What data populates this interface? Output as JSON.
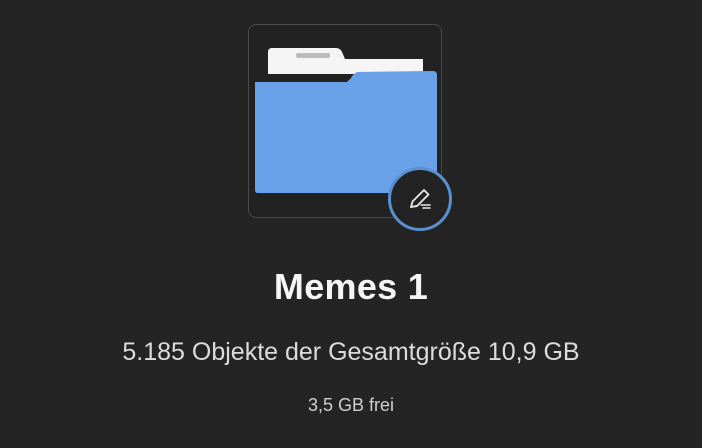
{
  "folder": {
    "name": "Memes 1",
    "summary": "5.185 Objekte der Gesamtgröße 10,9 GB",
    "free_space": "3,5 GB frei",
    "icon": "folder-icon",
    "folder_color": "#69a1e8",
    "paper_color": "#f5f5f5"
  },
  "edit_button": {
    "icon": "pen-edit-icon",
    "ring_color": "#5a8fd0"
  }
}
